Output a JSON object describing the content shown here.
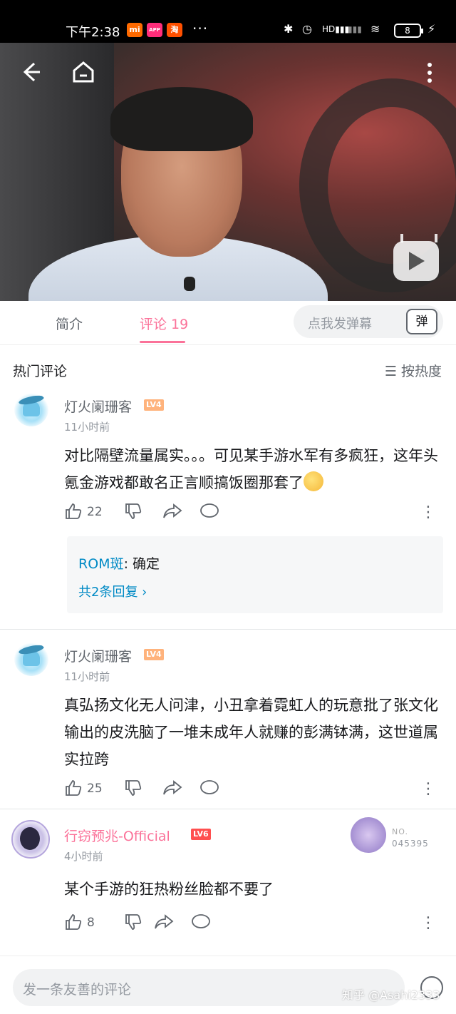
{
  "status_bar": {
    "time": "下午2:38",
    "apps": [
      "mi",
      "淘"
    ],
    "more": "···",
    "battery": "8"
  },
  "video": {
    "back_icon": "arrow-left-icon",
    "home_icon": "home-icon",
    "menu_icon": "more-vertical-icon",
    "tv_icon": "bilibili-tv-icon"
  },
  "tabs": {
    "intro": "简介",
    "comments": "评论 19"
  },
  "danmaku": {
    "placeholder": "点我发弹幕",
    "icon_label": "弹"
  },
  "comments_header": {
    "title": "热门评论",
    "sort": "☰ 按热度"
  },
  "comments": [
    {
      "user": "灯火阑珊客",
      "level": "LV4",
      "time": "11小时前",
      "text": "对比隔壁流量属实。。。可见某手游水军有多疯狂，这年头氪金游戏都敢名正言顺搞饭圈那套了",
      "likes": "22",
      "reply": {
        "name": "ROM斑",
        "text": ": 确定",
        "more": "共2条回复 ›"
      }
    },
    {
      "user": "灯火阑珊客",
      "level": "LV4",
      "time": "11小时前",
      "text": "真弘扬文化无人问津，小丑拿着霓虹人的玩意批了张文化输出的皮洗脑了一堆未成年人就赚的彭满钵满，这世道属实拉跨",
      "likes": "25"
    },
    {
      "user": "行窃预兆-Official",
      "level": "LV6",
      "time": "4小时前",
      "text": "某个手游的狂热粉丝脸都不要了",
      "likes": "8",
      "badge_no": "NO.",
      "badge_num": "045395"
    }
  ],
  "bottom": {
    "placeholder": "发一条友善的评论",
    "watermark": "知乎 @Asahi2333"
  }
}
